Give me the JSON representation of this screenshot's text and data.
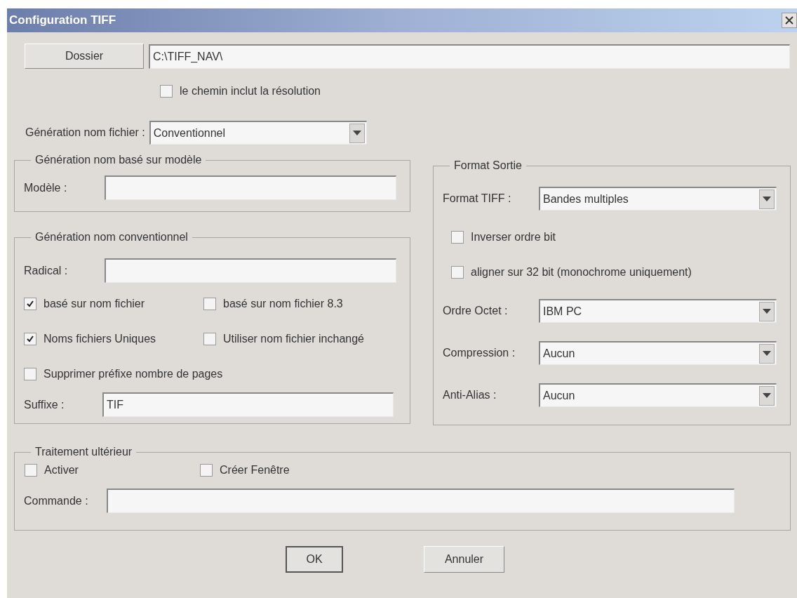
{
  "window": {
    "title": "Configuration TIFF"
  },
  "folder": {
    "button": "Dossier",
    "path": "C:\\TIFF_NAV\\"
  },
  "path_option": {
    "label": "le chemin inclut la résolution",
    "checked": false
  },
  "filename_generation": {
    "label": "Génération nom fichier :",
    "value": "Conventionnel"
  },
  "template_group": {
    "title": "Génération nom basé sur modèle",
    "label": "Modèle :"
  },
  "conventional_group": {
    "title": "Génération nom conventionnel",
    "radical_label": "Radical :",
    "checkboxes": [
      {
        "label": "basé sur nom fichier",
        "checked": true
      },
      {
        "label": "basé sur nom fichier 8.3",
        "checked": false
      },
      {
        "label": "Noms fichiers Uniques",
        "checked": true
      },
      {
        "label": "Utiliser nom fichier inchangé",
        "checked": false
      },
      {
        "label": "Supprimer préfixe nombre de pages",
        "checked": false
      }
    ],
    "suffix_label": "Suffixe :",
    "suffix_value": "TIF"
  },
  "output_group": {
    "title": "Format Sortie",
    "format": {
      "label": "Format TIFF :",
      "value": "Bandes multiples"
    },
    "checkboxes": [
      {
        "label": "Inverser ordre bit",
        "checked": false
      },
      {
        "label": "aligner sur 32 bit (monochrome uniquement)",
        "checked": false
      }
    ],
    "selects": [
      {
        "label": "Ordre Octet :",
        "value": "IBM PC"
      },
      {
        "label": "Compression :",
        "value": "Aucun"
      },
      {
        "label": "Anti-Alias :",
        "value": "Aucun"
      }
    ]
  },
  "post_processing": {
    "title": "Traitement ultérieur",
    "checkboxes": [
      {
        "label": "Activer",
        "checked": false
      },
      {
        "label": "Créer Fenêtre",
        "checked": false
      }
    ],
    "command_label": "Commande :"
  },
  "buttons": [
    {
      "label": "OK",
      "default": true
    },
    {
      "label": "Annuler",
      "default": false
    }
  ]
}
